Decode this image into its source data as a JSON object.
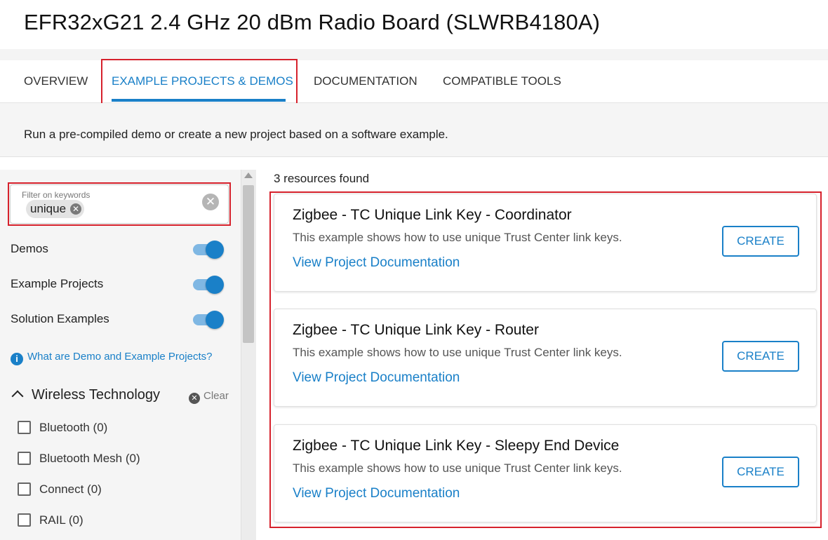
{
  "page": {
    "title": "EFR32xG21 2.4 GHz 20 dBm Radio Board (SLWRB4180A)"
  },
  "tabs": [
    {
      "label": "OVERVIEW",
      "active": false
    },
    {
      "label": "EXAMPLE PROJECTS & DEMOS",
      "active": true
    },
    {
      "label": "DOCUMENTATION",
      "active": false
    },
    {
      "label": "COMPATIBLE TOOLS",
      "active": false
    }
  ],
  "intro": {
    "text": "Run a pre-compiled demo or create a new project based on a software example."
  },
  "sidebar": {
    "filter": {
      "label": "Filter on keywords",
      "chip": "unique"
    },
    "toggles": [
      {
        "label": "Demos",
        "on": true
      },
      {
        "label": "Example Projects",
        "on": true
      },
      {
        "label": "Solution Examples",
        "on": true
      }
    ],
    "info_link": "What are Demo and Example Projects?",
    "section": {
      "title": "Wireless Technology",
      "clear_label": "Clear"
    },
    "checkboxes": [
      {
        "label": "Bluetooth (0)",
        "checked": false
      },
      {
        "label": "Bluetooth Mesh (0)",
        "checked": false
      },
      {
        "label": "Connect (0)",
        "checked": false
      },
      {
        "label": "RAIL (0)",
        "checked": false
      }
    ]
  },
  "results": {
    "count_text": "3 resources found",
    "cards": [
      {
        "title": "Zigbee - TC Unique Link Key - Coordinator",
        "description": "This example shows how to use unique Trust Center link keys.",
        "link": "View Project Documentation",
        "button": "CREATE"
      },
      {
        "title": "Zigbee - TC Unique Link Key - Router",
        "description": "This example shows how to use unique Trust Center link keys.",
        "link": "View Project Documentation",
        "button": "CREATE"
      },
      {
        "title": "Zigbee - TC Unique Link Key - Sleepy End Device",
        "description": "This example shows how to use unique Trust Center link keys.",
        "link": "View Project Documentation",
        "button": "CREATE"
      }
    ]
  },
  "colors": {
    "accent": "#1a80c8",
    "highlight": "#d6212c"
  }
}
